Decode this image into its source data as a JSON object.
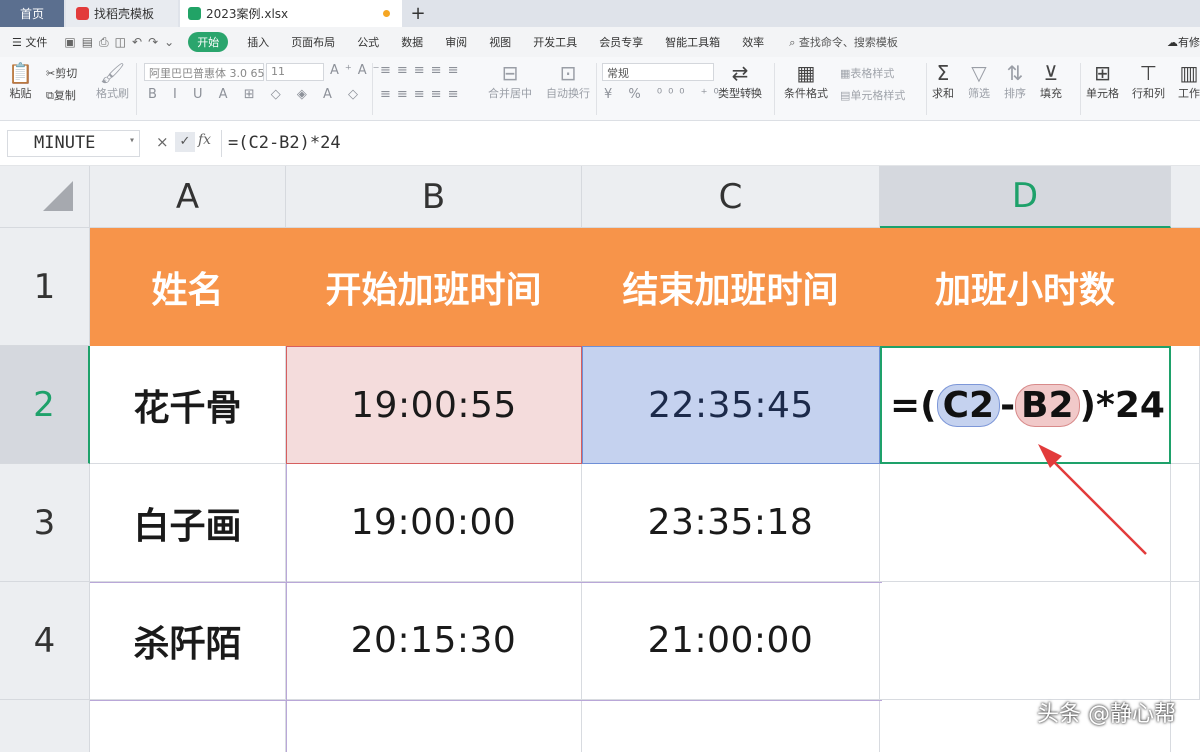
{
  "tabs": {
    "home": "首页",
    "template": "找稻壳模板",
    "file": "2023案例.xlsx",
    "new_tab": "+"
  },
  "menu": {
    "file": "文件",
    "items": [
      "开始",
      "插入",
      "页面布局",
      "公式",
      "数据",
      "审阅",
      "视图",
      "开发工具",
      "会员专享",
      "智能工具箱",
      "效率"
    ],
    "search": "查找命令、搜索模板",
    "cloud": "有修"
  },
  "ribbon": {
    "paste": "粘贴",
    "cut": "剪切",
    "copy": "复制",
    "format_painter": "格式刷",
    "font_name": "阿里巴巴普惠体 3.0 65",
    "font_size": "11",
    "merge_center": "合并居中",
    "wrap_text": "自动换行",
    "number_format": "常规",
    "type_convert": "类型转换",
    "cond_format": "条件格式",
    "table_style": "表格样式",
    "cell_style": "单元格样式",
    "sum": "求和",
    "filter": "筛选",
    "sort": "排序",
    "fill": "填充",
    "cell": "单元格",
    "row_col": "行和列",
    "worksheet": "工作"
  },
  "formula_bar": {
    "name_box": "MINUTE",
    "cancel": "×",
    "confirm": "✓",
    "fx": "fx",
    "formula": "=(C2-B2)*24"
  },
  "grid": {
    "columns": [
      "A",
      "B",
      "C",
      "D"
    ],
    "rows": [
      "1",
      "2",
      "3",
      "4"
    ],
    "header": [
      "姓名",
      "开始加班时间",
      "结束加班时间",
      "加班小时数"
    ],
    "data": [
      {
        "name": "花千骨",
        "start": "19:00:55",
        "end": "22:35:45"
      },
      {
        "name": "白子画",
        "start": "19:00:00",
        "end": "23:35:18"
      },
      {
        "name": "杀阡陌",
        "start": "20:15:30",
        "end": "21:00:00"
      }
    ],
    "editing": {
      "prefix": "=(",
      "ref1": "C2",
      "op": "-",
      "ref2": "B2",
      "suffix": ")*24"
    }
  },
  "watermark": "头条 @静心帮",
  "colors": {
    "accent": "#1ea16a",
    "header_fill": "#f7944a",
    "ref_b": "#f4dcdc",
    "ref_c": "#c5d2ef",
    "arrow": "#e23b3b"
  }
}
